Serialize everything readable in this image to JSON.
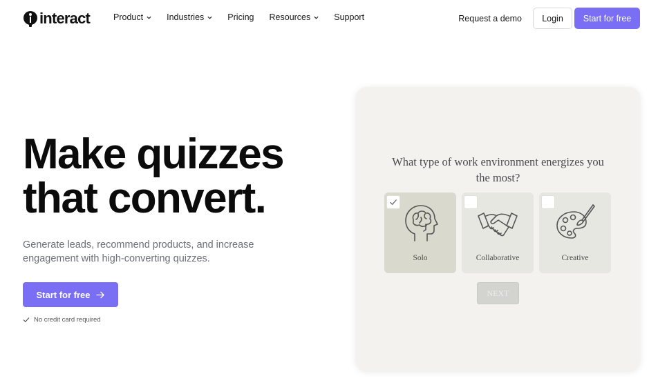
{
  "nav": {
    "logo_text": "interact",
    "menu": [
      {
        "label": "Product",
        "dropdown": true
      },
      {
        "label": "Industries",
        "dropdown": true
      },
      {
        "label": "Pricing",
        "dropdown": false
      },
      {
        "label": "Resources",
        "dropdown": true
      },
      {
        "label": "Support",
        "dropdown": false
      }
    ],
    "demo_link": "Request a demo",
    "login_label": "Login",
    "cta_label": "Start for free"
  },
  "hero": {
    "headline_line1": "Make quizzes",
    "headline_line2": "that convert.",
    "subtext": "Generate leads, recommend products, and increase engagement with high-converting quizzes.",
    "cta_label": "Start for free",
    "note": "No credit card required"
  },
  "quiz": {
    "question": "What type of work environment energizes you the most?",
    "options": [
      {
        "label": "Solo",
        "icon": "brain-head-icon",
        "selected": true
      },
      {
        "label": "Collaborative",
        "icon": "handshake-icon",
        "selected": false
      },
      {
        "label": "Creative",
        "icon": "palette-icon",
        "selected": false
      }
    ],
    "next_label": "NEXT"
  },
  "colors": {
    "accent": "#7a6ef5",
    "card_bg": "#f3f2ee",
    "option_bg": "#e7e7e1",
    "option_selected_bg": "#dad9cd"
  }
}
